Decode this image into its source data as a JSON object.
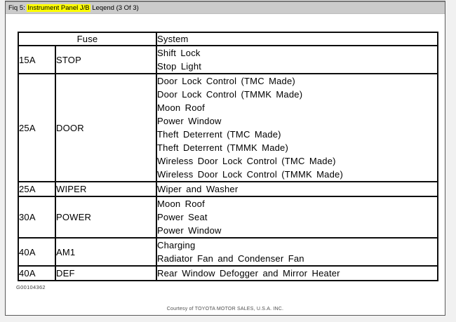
{
  "window": {
    "title_prefix": "Fiq 5: ",
    "title_highlight": "Instrument Panel J/B",
    "title_suffix": " Leqend (3 Of 3)",
    "highlight_color": "#ffff00",
    "titlebar_bg": "#cbcbcb"
  },
  "table": {
    "headers": {
      "fuse": "Fuse",
      "system": "System"
    },
    "rows": [
      {
        "amp": "15A",
        "name": "STOP",
        "systems": [
          "Shift Lock",
          "Stop Light"
        ]
      },
      {
        "amp": "25A",
        "name": "DOOR",
        "systems": [
          "Door Lock Control (TMC Made)",
          "Door Lock Control (TMMK Made)",
          "Moon Roof",
          "Power Window",
          "Theft Deterrent (TMC Made)",
          "Theft Deterrent (TMMK Made)",
          "Wireless Door Lock Control (TMC Made)",
          "Wireless Door Lock Control (TMMK Made)"
        ]
      },
      {
        "amp": "25A",
        "name": "WIPER",
        "systems": [
          "Wiper and Washer"
        ]
      },
      {
        "amp": "30A",
        "name": "POWER",
        "systems": [
          "Moon Roof",
          "Power Seat",
          "Power Window"
        ]
      },
      {
        "amp": "40A",
        "name": "AM1",
        "systems": [
          "Charging",
          "Radiator Fan and Condenser Fan"
        ]
      },
      {
        "amp": "40A",
        "name": "DEF",
        "systems": [
          "Rear Window Defogger and Mirror Heater"
        ]
      }
    ]
  },
  "footer": {
    "figure_id": "G00104362",
    "courtesy": "Courtesy of TOYOTA MOTOR SALES, U.S.A. INC."
  }
}
